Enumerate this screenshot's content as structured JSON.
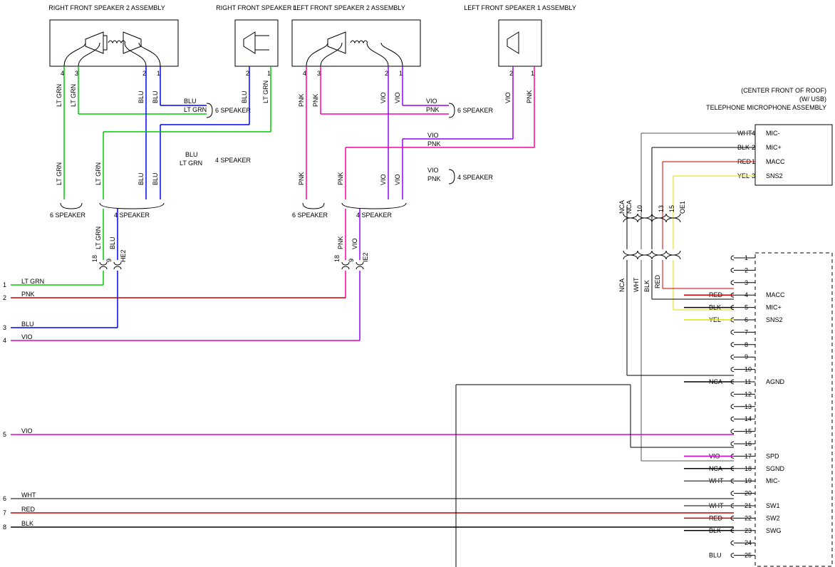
{
  "components": {
    "rf_spk2": "RIGHT FRONT SPEAKER 2 ASSEMBLY",
    "rf_spk1": "RIGHT FRONT SPEAKER 1",
    "lf_spk2": "LEFT FRONT SPEAKER 2 ASSEMBLY",
    "lf_spk1": "LEFT FRONT SPEAKER 1 ASSEMBLY",
    "mic_header1": "(CENTER FRONT OF ROOF)",
    "mic_header2": "(W/ USB)",
    "mic_header3": "TELEPHONE MICROPHONE ASSEMBLY"
  },
  "wire_colors": {
    "lt_grn": "LT GRN",
    "blu": "BLU",
    "pnk": "PNK",
    "vio": "VIO",
    "wht": "WHT",
    "blk": "BLK",
    "red": "RED",
    "yel": "YEL",
    "nca": "NCA"
  },
  "speaker_cfg": {
    "six": "6 SPEAKER",
    "four": "4 SPEAKER"
  },
  "mic_pins": {
    "p1": {
      "num": "4",
      "color": "WHT",
      "sig": "MIC-"
    },
    "p2": {
      "num": "2",
      "color": "BLK",
      "sig": "MIC+"
    },
    "p3": {
      "num": "1",
      "color": "RED",
      "sig": "MACC"
    },
    "p4": {
      "num": "3",
      "color": "YEL",
      "sig": "SNS2"
    }
  },
  "splice": {
    "s18": "18",
    "s9": "9",
    "he2": "HE2",
    "ie2": "IE2",
    "oe1": "OE1",
    "n10": "10",
    "n13": "13",
    "n15": "15",
    "nca": "NCA"
  },
  "left_conn": {
    "p1": "1",
    "p2": "2",
    "p3": "3",
    "p4": "4",
    "p5": "5",
    "p6": "6",
    "p7": "7",
    "p8": "8"
  },
  "right_conn": {
    "rows": [
      {
        "n": "1",
        "c": "",
        "s": ""
      },
      {
        "n": "2",
        "c": "",
        "s": ""
      },
      {
        "n": "3",
        "c": "",
        "s": ""
      },
      {
        "n": "4",
        "c": "RED",
        "s": "MACC"
      },
      {
        "n": "5",
        "c": "BLK",
        "s": "MIC+"
      },
      {
        "n": "6",
        "c": "YEL",
        "s": "SNS2"
      },
      {
        "n": "7",
        "c": "",
        "s": ""
      },
      {
        "n": "8",
        "c": "",
        "s": ""
      },
      {
        "n": "9",
        "c": "",
        "s": ""
      },
      {
        "n": "10",
        "c": "",
        "s": ""
      },
      {
        "n": "11",
        "c": "NCA",
        "s": "AGND"
      },
      {
        "n": "12",
        "c": "",
        "s": ""
      },
      {
        "n": "13",
        "c": "",
        "s": ""
      },
      {
        "n": "14",
        "c": "",
        "s": ""
      },
      {
        "n": "15",
        "c": "",
        "s": ""
      },
      {
        "n": "16",
        "c": "",
        "s": ""
      },
      {
        "n": "17",
        "c": "VIO",
        "s": "SPD"
      },
      {
        "n": "18",
        "c": "NCA",
        "s": "SGND"
      },
      {
        "n": "19",
        "c": "WHT",
        "s": "MIC-"
      },
      {
        "n": "20",
        "c": "",
        "s": ""
      },
      {
        "n": "21",
        "c": "WHT",
        "s": "SW1"
      },
      {
        "n": "22",
        "c": "RED",
        "s": "SW2"
      },
      {
        "n": "23",
        "c": "BLK",
        "s": "SWG"
      },
      {
        "n": "24",
        "c": "",
        "s": ""
      },
      {
        "n": "25",
        "c": "BLU",
        "s": ""
      }
    ]
  },
  "left_wires": [
    {
      "n": "1",
      "c": "LT GRN"
    },
    {
      "n": "2",
      "c": "PNK"
    },
    {
      "n": "3",
      "c": "BLU"
    },
    {
      "n": "4",
      "c": "VIO"
    },
    {
      "n": "5",
      "c": "VIO"
    },
    {
      "n": "6",
      "c": "WHT"
    },
    {
      "n": "7",
      "c": "RED"
    },
    {
      "n": "8",
      "c": "BLK"
    }
  ],
  "nums": {
    "n1": "1",
    "n2": "2",
    "n3": "3",
    "n4": "4"
  }
}
